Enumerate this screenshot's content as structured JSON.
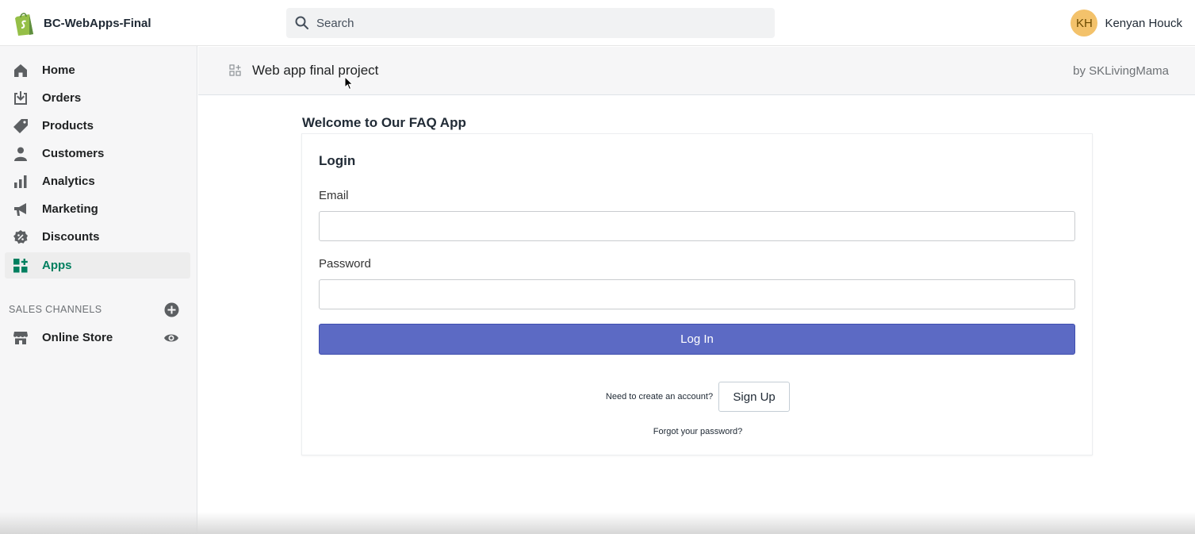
{
  "topbar": {
    "store_name": "BC-WebApps-Final",
    "logo_icon": "shopify-bag-icon",
    "search": {
      "placeholder": "Search"
    },
    "user": {
      "initials": "KH",
      "name": "Kenyan Houck",
      "avatar_color": "#f3c26b"
    }
  },
  "sidebar": {
    "items": [
      {
        "label": "Home",
        "icon": "home-icon",
        "active": false
      },
      {
        "label": "Orders",
        "icon": "orders-icon",
        "active": false
      },
      {
        "label": "Products",
        "icon": "tag-icon",
        "active": false
      },
      {
        "label": "Customers",
        "icon": "person-icon",
        "active": false
      },
      {
        "label": "Analytics",
        "icon": "bar-chart-icon",
        "active": false
      },
      {
        "label": "Marketing",
        "icon": "megaphone-icon",
        "active": false
      },
      {
        "label": "Discounts",
        "icon": "discount-icon",
        "active": false
      },
      {
        "label": "Apps",
        "icon": "apps-icon",
        "active": true
      }
    ],
    "sales_channels": {
      "title": "SALES CHANNELS",
      "items": [
        {
          "label": "Online Store",
          "icon": "store-icon"
        }
      ]
    }
  },
  "app_header": {
    "title": "Web app final project",
    "by": "by SKLivingMama"
  },
  "main": {
    "welcome": "Welcome to Our FAQ App",
    "login": {
      "title": "Login",
      "email_label": "Email",
      "email_value": "",
      "password_label": "Password",
      "password_value": "",
      "login_button": "Log In",
      "signup_prompt": "Need to create an account?",
      "signup_button": "Sign Up",
      "forgot": "Forgot your password?"
    }
  },
  "colors": {
    "accent": "#5c6ac4",
    "active_nav": "#007f5f",
    "brand_green": "#95bf47"
  }
}
